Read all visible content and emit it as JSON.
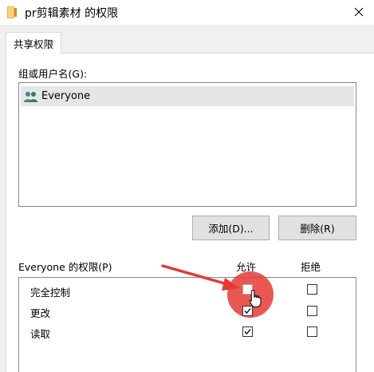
{
  "window": {
    "title": "pr剪辑素材 的权限",
    "folder_icon": "folder-icon",
    "close_icon": "close-icon"
  },
  "tabs": [
    {
      "label": "共享权限",
      "active": true
    }
  ],
  "group_section": {
    "label": "组或用户名(G):",
    "users": [
      {
        "name": "Everyone",
        "icon": "users-icon",
        "selected": true
      }
    ]
  },
  "buttons": {
    "add": "添加(D)...",
    "remove": "删除(R)"
  },
  "permissions": {
    "label": "Everyone 的权限(P)",
    "allow_header": "允许",
    "deny_header": "拒绝",
    "rows": [
      {
        "name": "完全控制",
        "allow": false,
        "deny": false
      },
      {
        "name": "更改",
        "allow": true,
        "deny": false
      },
      {
        "name": "读取",
        "allow": true,
        "deny": false
      }
    ]
  },
  "annotation": {
    "color": "#e53935",
    "arrow_icon": "red-arrow-icon",
    "cursor_icon": "hand-cursor-icon"
  }
}
